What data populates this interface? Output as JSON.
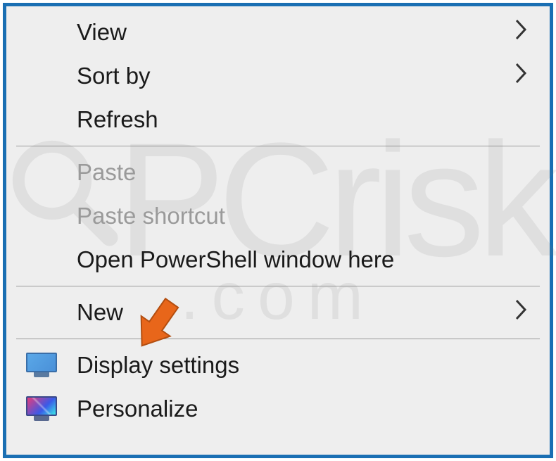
{
  "menu": {
    "items": [
      {
        "label": "View",
        "submenu": true,
        "enabled": true,
        "icon": null
      },
      {
        "label": "Sort by",
        "submenu": true,
        "enabled": true,
        "icon": null
      },
      {
        "label": "Refresh",
        "submenu": false,
        "enabled": true,
        "icon": null
      },
      {
        "separator": true
      },
      {
        "label": "Paste",
        "submenu": false,
        "enabled": false,
        "icon": null
      },
      {
        "label": "Paste shortcut",
        "submenu": false,
        "enabled": false,
        "icon": null
      },
      {
        "label": "Open PowerShell window here",
        "submenu": false,
        "enabled": true,
        "icon": null
      },
      {
        "separator": true
      },
      {
        "label": "New",
        "submenu": true,
        "enabled": true,
        "icon": null
      },
      {
        "separator": true
      },
      {
        "label": "Display settings",
        "submenu": false,
        "enabled": true,
        "icon": "monitor"
      },
      {
        "label": "Personalize",
        "submenu": false,
        "enabled": true,
        "icon": "personalize"
      }
    ]
  },
  "watermark": {
    "top": "PCrisk",
    "bottom": ".com"
  },
  "annotation": {
    "type": "arrow",
    "color": "#e8661a",
    "target": "Display settings"
  }
}
